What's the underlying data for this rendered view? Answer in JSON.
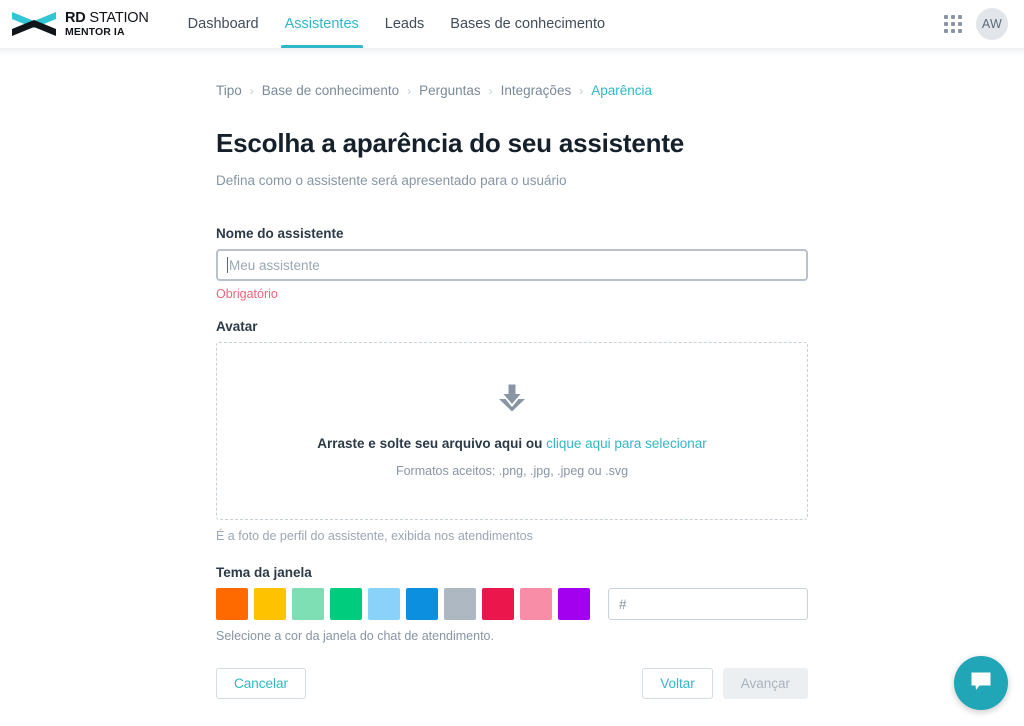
{
  "header": {
    "logo": {
      "brand_bold": "RD",
      "brand_rest": " STATION",
      "product": "MENTOR IA",
      "chevron_top_color": "#31c6d4",
      "chevron_bottom_color": "#111418"
    },
    "nav": [
      {
        "label": "Dashboard",
        "active": false
      },
      {
        "label": "Assistentes",
        "active": true
      },
      {
        "label": "Leads",
        "active": false
      },
      {
        "label": "Bases de conhecimento",
        "active": false
      }
    ],
    "apps_icon": "grid-apps-icon",
    "user_initials": "AW"
  },
  "breadcrumb": [
    {
      "label": "Tipo",
      "current": false
    },
    {
      "label": "Base de conhecimento",
      "current": false
    },
    {
      "label": "Perguntas",
      "current": false
    },
    {
      "label": "Integrações",
      "current": false
    },
    {
      "label": "Aparência",
      "current": true
    }
  ],
  "breadcrumb_separator": "›",
  "page": {
    "title": "Escolha a aparência do seu assistente",
    "subtitle": "Defina como o assistente será apresentado para o usuário"
  },
  "name_field": {
    "label": "Nome do assistente",
    "value": "",
    "placeholder": "Meu assistente",
    "error": "Obrigatório"
  },
  "avatar_field": {
    "label": "Avatar",
    "icon": "download-tray-icon",
    "drop_text": "Arraste e solte seu arquivo aqui ou ",
    "drop_link": "clique aqui para selecionar",
    "formats": "Formatos aceitos: .png, .jpg, .jpeg ou .svg",
    "helper": "É a foto de perfil do assistente, exibida nos atendimentos"
  },
  "theme_field": {
    "label": "Tema da janela",
    "helper": "Selecione a cor da janela do chat de atendimento.",
    "hex_placeholder": "#",
    "hex_value": "",
    "swatches": [
      {
        "name": "orange",
        "color": "#FF6A00"
      },
      {
        "name": "amber",
        "color": "#FFC200"
      },
      {
        "name": "mint",
        "color": "#7FDFB4"
      },
      {
        "name": "emerald",
        "color": "#00CC7E"
      },
      {
        "name": "sky",
        "color": "#8BD2FB"
      },
      {
        "name": "blue",
        "color": "#0D8FE0"
      },
      {
        "name": "slate",
        "color": "#AEB8C2"
      },
      {
        "name": "crimson",
        "color": "#EA164C"
      },
      {
        "name": "pink",
        "color": "#F78DA7"
      },
      {
        "name": "purple",
        "color": "#A400F0"
      }
    ]
  },
  "actions": {
    "cancel": "Cancelar",
    "back": "Voltar",
    "next": "Avançar",
    "next_disabled": true
  },
  "chat_widget": {
    "icon": "chat-bubble-icon",
    "color": "#21a6b8"
  }
}
